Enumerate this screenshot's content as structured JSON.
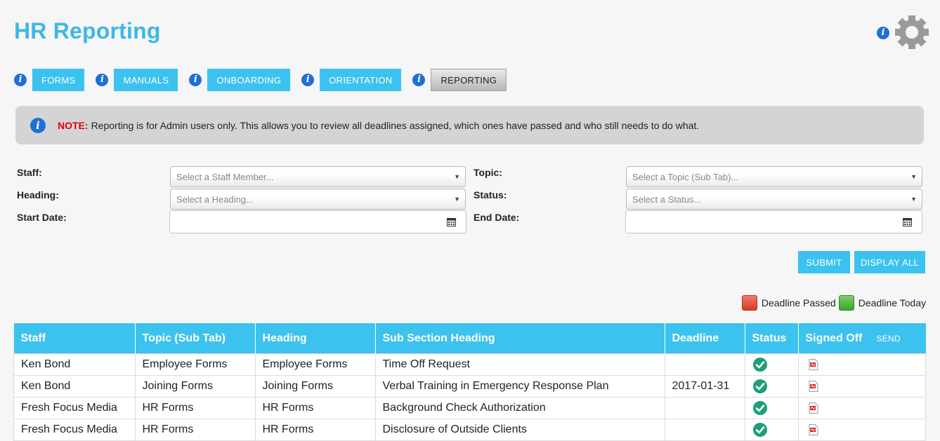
{
  "page": {
    "title": "HR Reporting"
  },
  "tabs": [
    {
      "label": "FORMS",
      "active": false
    },
    {
      "label": "MANUALS",
      "active": false
    },
    {
      "label": "ONBOARDING",
      "active": false
    },
    {
      "label": "ORIENTATION",
      "active": false
    },
    {
      "label": "REPORTING",
      "active": true
    }
  ],
  "note": {
    "label": "NOTE:",
    "text": "Reporting is for Admin users only. This allows you to review all deadlines assigned, which ones have passed and who still needs to do what."
  },
  "filters": {
    "staff_label": "Staff:",
    "staff_placeholder": "Select a Staff Member...",
    "heading_label": "Heading:",
    "heading_placeholder": "Select a Heading...",
    "start_label": "Start Date:",
    "topic_label": "Topic:",
    "topic_placeholder": "Select a Topic (Sub Tab)...",
    "status_label": "Status:",
    "status_placeholder": "Select a Status...",
    "end_label": "End Date:"
  },
  "buttons": {
    "submit": "SUBMIT",
    "display_all": "DISPLAY ALL"
  },
  "legend": {
    "passed": "Deadline Passed",
    "today": "Deadline Today"
  },
  "colors": {
    "accent": "#3cc2ee",
    "title": "#3cb8e6",
    "info": "#1f6fd8",
    "check": "#1e9e7a",
    "note_label": "#e00000"
  },
  "table": {
    "headers": [
      "Staff",
      "Topic (Sub Tab)",
      "Heading",
      "Sub Section Heading",
      "Deadline",
      "Status",
      "Signed Off"
    ],
    "send_label": "SEND",
    "rows": [
      {
        "staff": "Ken Bond",
        "topic": "Employee Forms",
        "heading": "Employee Forms",
        "sub": "Time Off Request",
        "deadline": ""
      },
      {
        "staff": "Ken Bond",
        "topic": "Joining Forms",
        "heading": "Joining Forms",
        "sub": "Verbal Training in Emergency Response Plan",
        "deadline": "2017-01-31"
      },
      {
        "staff": "Fresh Focus Media",
        "topic": "HR Forms",
        "heading": "HR Forms",
        "sub": "Background Check Authorization",
        "deadline": ""
      },
      {
        "staff": "Fresh Focus Media",
        "topic": "HR Forms",
        "heading": "HR Forms",
        "sub": "Disclosure of Outside Clients",
        "deadline": ""
      }
    ]
  }
}
